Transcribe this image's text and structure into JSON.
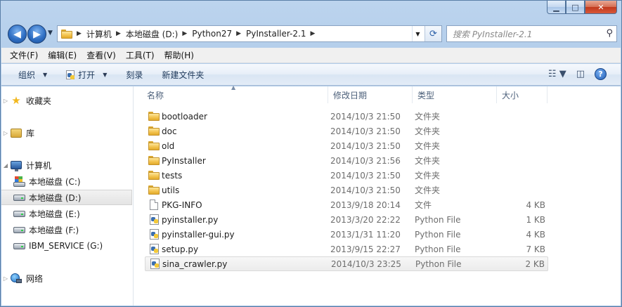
{
  "address": {
    "crumbs": [
      "计算机",
      "本地磁盘 (D:)",
      "Python27",
      "PyInstaller-2.1"
    ]
  },
  "search": {
    "placeholder": "搜索 PyInstaller-2.1"
  },
  "menu": [
    "文件(F)",
    "编辑(E)",
    "查看(V)",
    "工具(T)",
    "帮助(H)"
  ],
  "commands": {
    "organize": "组织",
    "open": "打开",
    "burn": "刻录",
    "new_folder": "新建文件夹"
  },
  "nav": {
    "favorites": "收藏夹",
    "libraries": "库",
    "computer": "计算机",
    "drive_c": "本地磁盘 (C:)",
    "drive_d": "本地磁盘 (D:)",
    "drive_e": "本地磁盘 (E:)",
    "drive_f": "本地磁盘 (F:)",
    "drive_g": "IBM_SERVICE (G:)",
    "network": "网络"
  },
  "columns": {
    "name": "名称",
    "date": "修改日期",
    "type": "类型",
    "size": "大小"
  },
  "files": [
    {
      "name": "bootloader",
      "date": "2014/10/3 21:50",
      "type": "文件夹",
      "size": "",
      "icon": "folder"
    },
    {
      "name": "doc",
      "date": "2014/10/3 21:50",
      "type": "文件夹",
      "size": "",
      "icon": "folder"
    },
    {
      "name": "old",
      "date": "2014/10/3 21:50",
      "type": "文件夹",
      "size": "",
      "icon": "folder"
    },
    {
      "name": "PyInstaller",
      "date": "2014/10/3 21:56",
      "type": "文件夹",
      "size": "",
      "icon": "folder"
    },
    {
      "name": "tests",
      "date": "2014/10/3 21:50",
      "type": "文件夹",
      "size": "",
      "icon": "folder"
    },
    {
      "name": "utils",
      "date": "2014/10/3 21:50",
      "type": "文件夹",
      "size": "",
      "icon": "folder"
    },
    {
      "name": "PKG-INFO",
      "date": "2013/9/18 20:14",
      "type": "文件",
      "size": "4 KB",
      "icon": "file"
    },
    {
      "name": "pyinstaller.py",
      "date": "2013/3/20 22:22",
      "type": "Python File",
      "size": "1 KB",
      "icon": "python"
    },
    {
      "name": "pyinstaller-gui.py",
      "date": "2013/1/31 11:20",
      "type": "Python File",
      "size": "4 KB",
      "icon": "python"
    },
    {
      "name": "setup.py",
      "date": "2013/9/15 22:27",
      "type": "Python File",
      "size": "7 KB",
      "icon": "python"
    },
    {
      "name": "sina_crawler.py",
      "date": "2014/10/3 23:25",
      "type": "Python File",
      "size": "2 KB",
      "icon": "python"
    }
  ]
}
